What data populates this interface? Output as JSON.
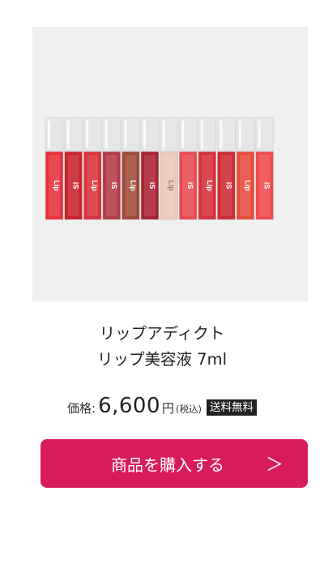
{
  "product": {
    "image_alt": "Lip addict lip gloss lineup",
    "brand_marks": [
      "Lipaddict",
      "iSKIN"
    ],
    "title_line1": "リップアディクト",
    "title_line2": "リップ美容液 7ml"
  },
  "price": {
    "label": "価格:",
    "value": "6,600",
    "currency": "円",
    "tax_note": "(税込)",
    "shipping_badge": "送料無料"
  },
  "buy_button": {
    "label": "商品を購入する",
    "arrow": "＞",
    "color": "#d81c5a"
  },
  "colors": {
    "image_background": "#f0f0f0",
    "badge_background": "#222222"
  }
}
